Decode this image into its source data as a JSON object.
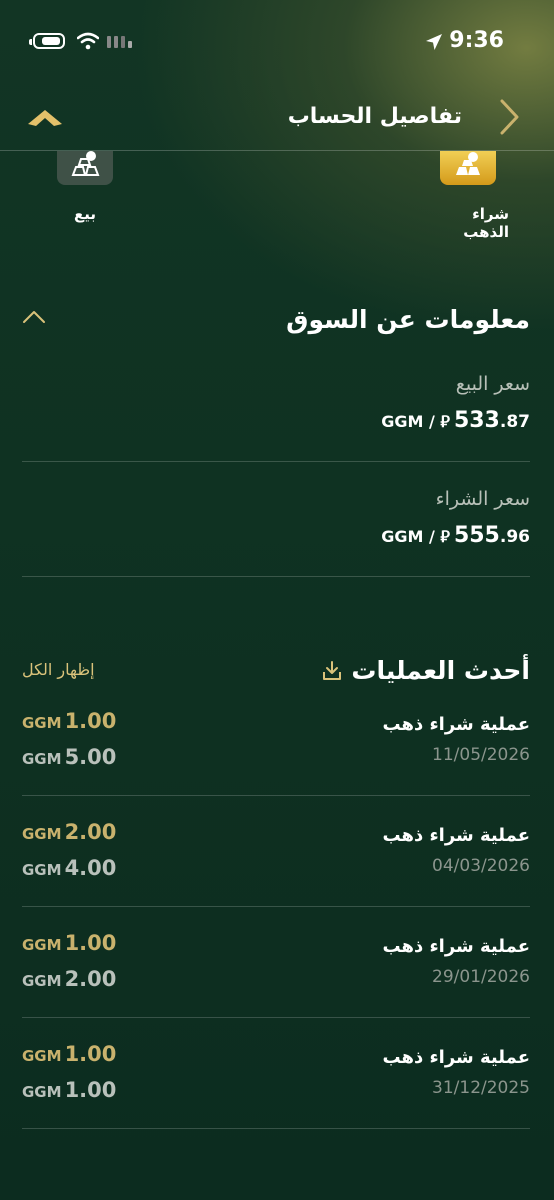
{
  "status_bar": {
    "time": "9:36"
  },
  "header": {
    "title": "تفاصيل الحساب"
  },
  "actions": [
    {
      "label": "شراء الذهب",
      "icon": "gold-bars-icon"
    },
    {
      "label": "بيع",
      "icon": "gold-bars-sell-icon"
    }
  ],
  "market": {
    "title": "معلومات عن السوق",
    "sell": {
      "label": "سعر البيع",
      "int": "533",
      "dec": ".87",
      "unit": "GGM / ⃁"
    },
    "buy": {
      "label": "سعر الشراء",
      "int": "555",
      "dec": ".96",
      "unit": "GGM / ⃁"
    }
  },
  "transactions": {
    "title": "أحدث العمليات",
    "show_all": "إظهار الكل",
    "items": [
      {
        "title": "عملية شراء ذهب",
        "date": "11/05/2026",
        "amount1": "1.00",
        "amount2": "5.00",
        "unit": "GGM"
      },
      {
        "title": "عملية شراء ذهب",
        "date": "04/03/2026",
        "amount1": "2.00",
        "amount2": "4.00",
        "unit": "GGM"
      },
      {
        "title": "عملية شراء ذهب",
        "date": "29/01/2026",
        "amount1": "1.00",
        "amount2": "2.00",
        "unit": "GGM"
      },
      {
        "title": "عملية شراء ذهب",
        "date": "31/12/2025",
        "amount1": "1.00",
        "amount2": "1.00",
        "unit": "GGM"
      }
    ]
  },
  "colors": {
    "gold": "#c9b26d",
    "accent_icon": "#e3ba3a",
    "background": "#0f3222"
  }
}
